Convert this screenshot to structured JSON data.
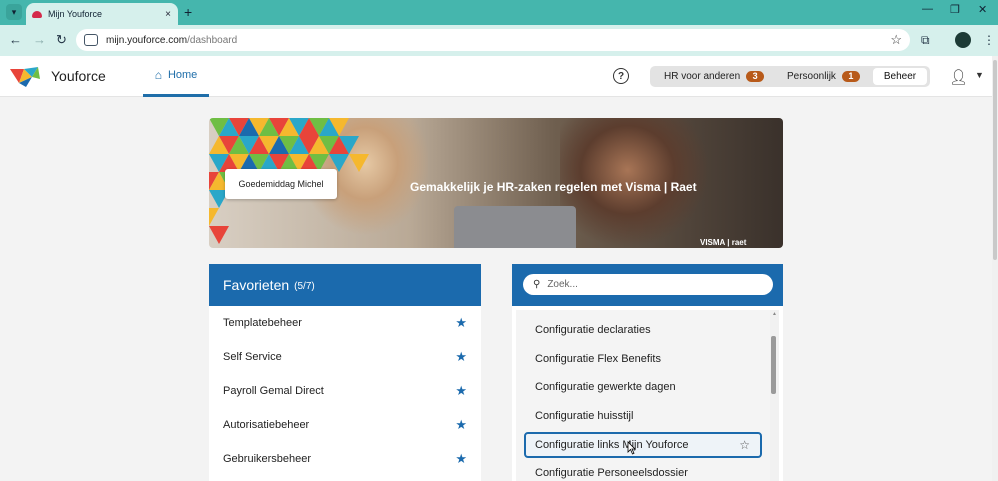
{
  "browser": {
    "tab_title": "Mijn Youforce",
    "tab_close": "×",
    "new_tab": "+",
    "url_host": "mijn.youforce.com",
    "url_path": "/dashboard",
    "window_controls": [
      "—",
      "❐",
      "✕"
    ]
  },
  "header": {
    "brand": "Youforce",
    "home_label": "Home",
    "help_symbol": "?",
    "hr_for_others_label": "HR voor anderen",
    "hr_for_others_count": "3",
    "personal_label": "Persoonlijk",
    "personal_count": "1",
    "admin_label": "Beheer"
  },
  "banner": {
    "greeting": "Goedemiddag Michel",
    "tagline": "Gemakkelijk je HR-zaken regelen met Visma | Raet",
    "brand_mark": "VISMA | raet"
  },
  "favorites": {
    "title": "Favorieten",
    "count": "(5/7)",
    "items": [
      {
        "label": "Templatebeheer"
      },
      {
        "label": "Self Service"
      },
      {
        "label": "Payroll Gemal Direct"
      },
      {
        "label": "Autorisatiebeheer"
      },
      {
        "label": "Gebruikersbeheer"
      }
    ]
  },
  "search": {
    "placeholder": "Zoek...",
    "results": [
      {
        "label": "Configuratie declaraties"
      },
      {
        "label": "Configuratie Flex Benefits"
      },
      {
        "label": "Configuratie gewerkte dagen"
      },
      {
        "label": "Configuratie huisstijl"
      },
      {
        "label": "Configuratie links Mijn Youforce"
      },
      {
        "label": "Configuratie Personeelsdossier"
      }
    ]
  },
  "colors": {
    "accent": "#1b6aad",
    "badge": "#b85a1a",
    "browser_tab_strip": "#45b6ad"
  }
}
